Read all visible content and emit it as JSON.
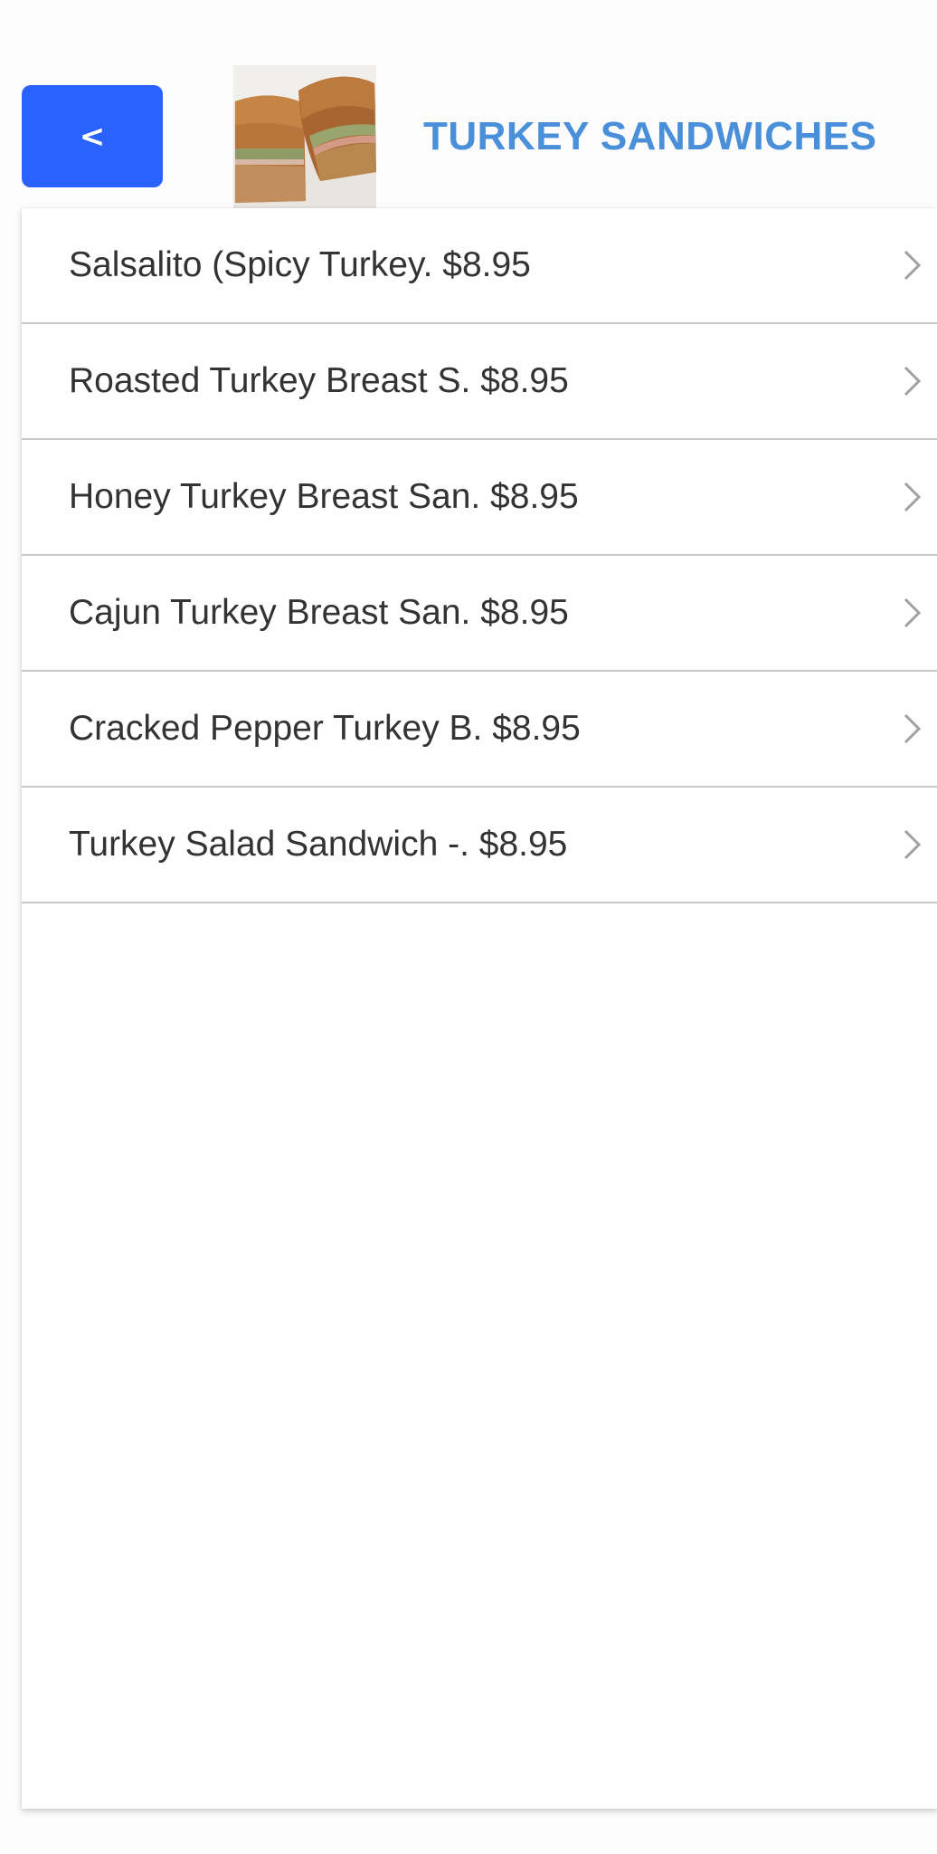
{
  "header": {
    "back_label": "<",
    "title": "TURKEY SANDWICHES",
    "thumbnail_icon": "sandwich-image"
  },
  "menu": {
    "items": [
      {
        "label": "Salsalito (Spicy Turkey. $8.95"
      },
      {
        "label": "Roasted Turkey Breast S. $8.95"
      },
      {
        "label": "Honey Turkey Breast San. $8.95"
      },
      {
        "label": "Cajun Turkey Breast San. $8.95"
      },
      {
        "label": "Cracked Pepper Turkey B. $8.95"
      },
      {
        "label": "Turkey Salad Sandwich -. $8.95"
      }
    ],
    "chevron_icon": "chevron-right-icon"
  },
  "colors": {
    "accent": "#2962ff",
    "title": "#4a8fd9",
    "divider": "#c8c8c8",
    "text": "#333333"
  }
}
